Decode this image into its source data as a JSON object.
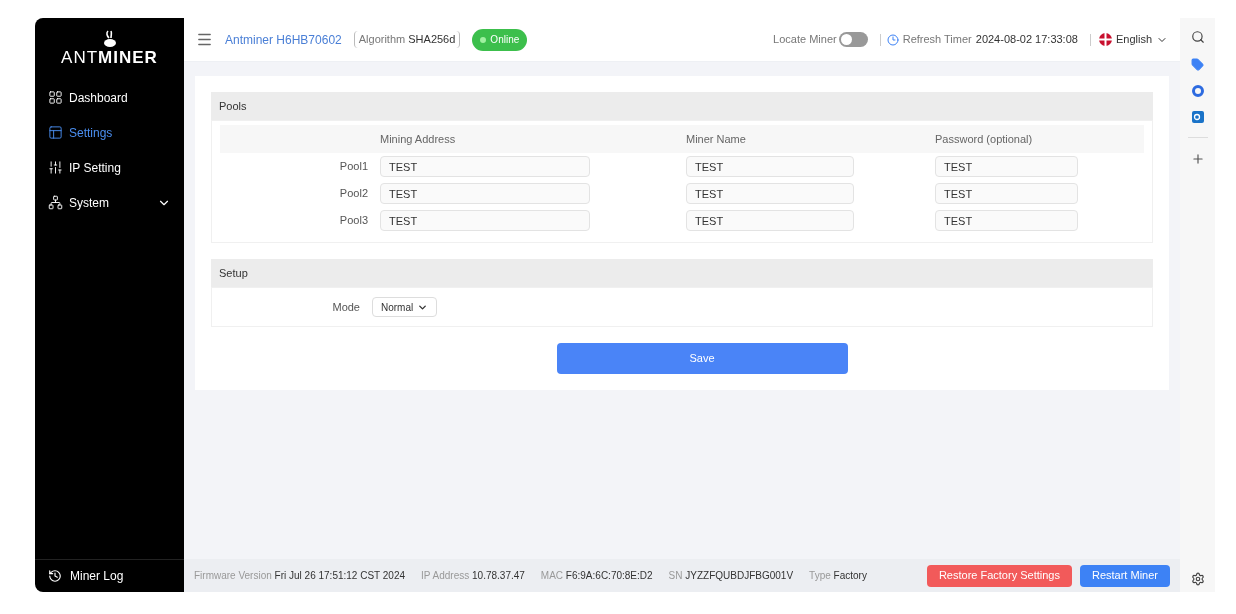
{
  "sidebar": {
    "logo": {
      "light": "ANT",
      "bold": "MINER"
    },
    "items": [
      {
        "label": "Dashboard",
        "selected": false,
        "kind": "dashboard"
      },
      {
        "label": "Settings",
        "selected": true,
        "kind": "settings"
      },
      {
        "label": "IP Setting",
        "selected": false,
        "kind": "ip"
      },
      {
        "label": "System",
        "selected": false,
        "kind": "system",
        "expanded": false
      }
    ],
    "footer_item": "Miner Log"
  },
  "header": {
    "miner": "Antminer H6HB70602",
    "algorithm_label": "Algorithm",
    "algorithm": "SHA256d",
    "status": "Online",
    "online": true,
    "locate_label": "Locate Miner",
    "locate_on": false,
    "refresh_label": "Refresh Timer",
    "refresh_time": "2024-08-02 17:33:08",
    "language": "English"
  },
  "pools": {
    "title": "Pools",
    "columns": [
      "Mining Address",
      "Miner Name",
      "Password (optional)"
    ],
    "rows": [
      {
        "label": "Pool1",
        "values": [
          "TEST",
          "TEST",
          "TEST"
        ]
      },
      {
        "label": "Pool2",
        "values": [
          "TEST",
          "TEST",
          "TEST"
        ]
      },
      {
        "label": "Pool3",
        "values": [
          "TEST",
          "TEST",
          "TEST"
        ]
      }
    ]
  },
  "setup": {
    "title": "Setup",
    "mode_label": "Mode",
    "mode": "Normal"
  },
  "save": "Save",
  "status_bar": [
    {
      "label": "Firmware Version",
      "value": "Fri Jul 26 17:51:12 CST 2024"
    },
    {
      "label": "IP Address",
      "value": "10.78.37.47"
    },
    {
      "label": "MAC",
      "value": "F6:9A:6C:70:8E:D2"
    },
    {
      "label": "SN",
      "value": "JYZZFQUBDJFBG001V"
    },
    {
      "label": "Type",
      "value": "Factory"
    }
  ],
  "buttons": [
    {
      "label": "Restore Factory Settings",
      "kind": "danger"
    },
    {
      "label": "Restart Miner",
      "kind": "primary"
    }
  ]
}
